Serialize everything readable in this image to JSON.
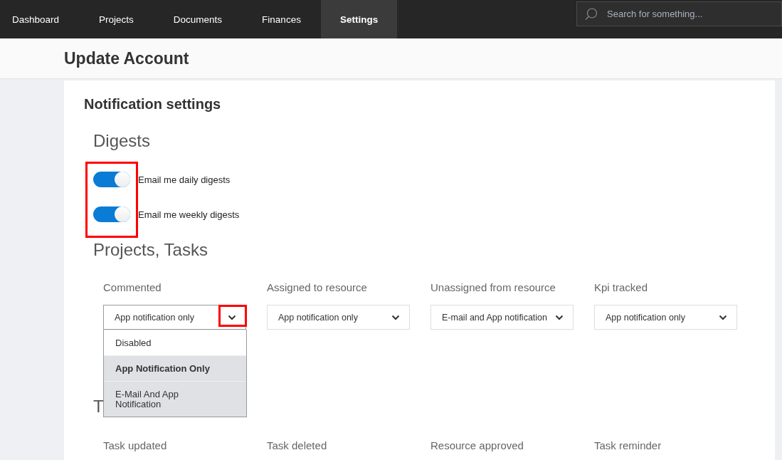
{
  "nav": {
    "tabs": [
      {
        "label": "Dashboard",
        "selected": false
      },
      {
        "label": "Projects",
        "selected": false
      },
      {
        "label": "Documents",
        "selected": false
      },
      {
        "label": "Finances",
        "selected": false
      },
      {
        "label": "Settings",
        "selected": true
      }
    ],
    "search": {
      "placeholder": "Search for something..."
    }
  },
  "page_title": "Update Account",
  "card": {
    "title": "Notification settings",
    "digests": {
      "heading": "Digests",
      "highlighted": true,
      "toggles": [
        {
          "label": "Email me daily digests",
          "on": true
        },
        {
          "label": "Email me weekly digests",
          "on": true
        }
      ]
    },
    "projects_tasks": {
      "heading": "Projects, Tasks",
      "fields": [
        {
          "label": "Commented",
          "value": "App notification only",
          "caret_highlighted": true,
          "expanded": true,
          "options": [
            {
              "label": "Disabled",
              "selected": false,
              "hovered": false
            },
            {
              "label": "App Notification Only",
              "selected": true,
              "hovered": false
            },
            {
              "label": "E-Mail And App Notification",
              "selected": false,
              "hovered": true
            }
          ]
        },
        {
          "label": "Assigned to resource",
          "value": "App notification only",
          "caret_highlighted": false,
          "expanded": false
        },
        {
          "label": "Unassigned from resource",
          "value": "E-mail and App notification",
          "caret_highlighted": false,
          "expanded": false
        },
        {
          "label": "Kpi tracked",
          "value": "App notification only",
          "caret_highlighted": false,
          "expanded": false
        }
      ]
    },
    "tasks": {
      "heading": "T",
      "fields": [
        {
          "label": "Task updated"
        },
        {
          "label": "Task deleted"
        },
        {
          "label": "Resource approved"
        },
        {
          "label": "Task reminder"
        }
      ]
    }
  }
}
